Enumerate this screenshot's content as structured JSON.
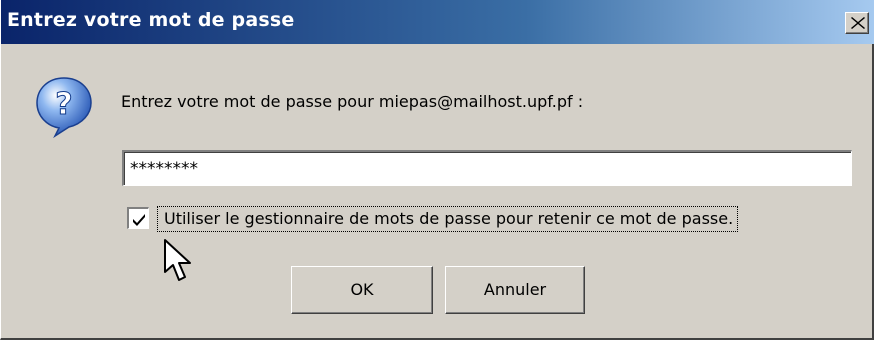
{
  "dialog": {
    "title": "Entrez votre mot de passe",
    "close_icon": "close-icon",
    "icon": "question-icon",
    "prompt": "Entrez votre mot de passe pour miepas@mailhost.upf.pf :",
    "password_value": "********",
    "remember_checkbox": {
      "checked": true,
      "label": "Utiliser le gestionnaire de mots de passe pour retenir ce mot de passe."
    },
    "buttons": {
      "ok_label": "OK",
      "cancel_label": "Annuler"
    }
  },
  "colors": {
    "face": "#d4d0c8",
    "titlebar_start": "#0a246a",
    "titlebar_end": "#a6caf0",
    "icon_blue": "#2a63c8"
  }
}
